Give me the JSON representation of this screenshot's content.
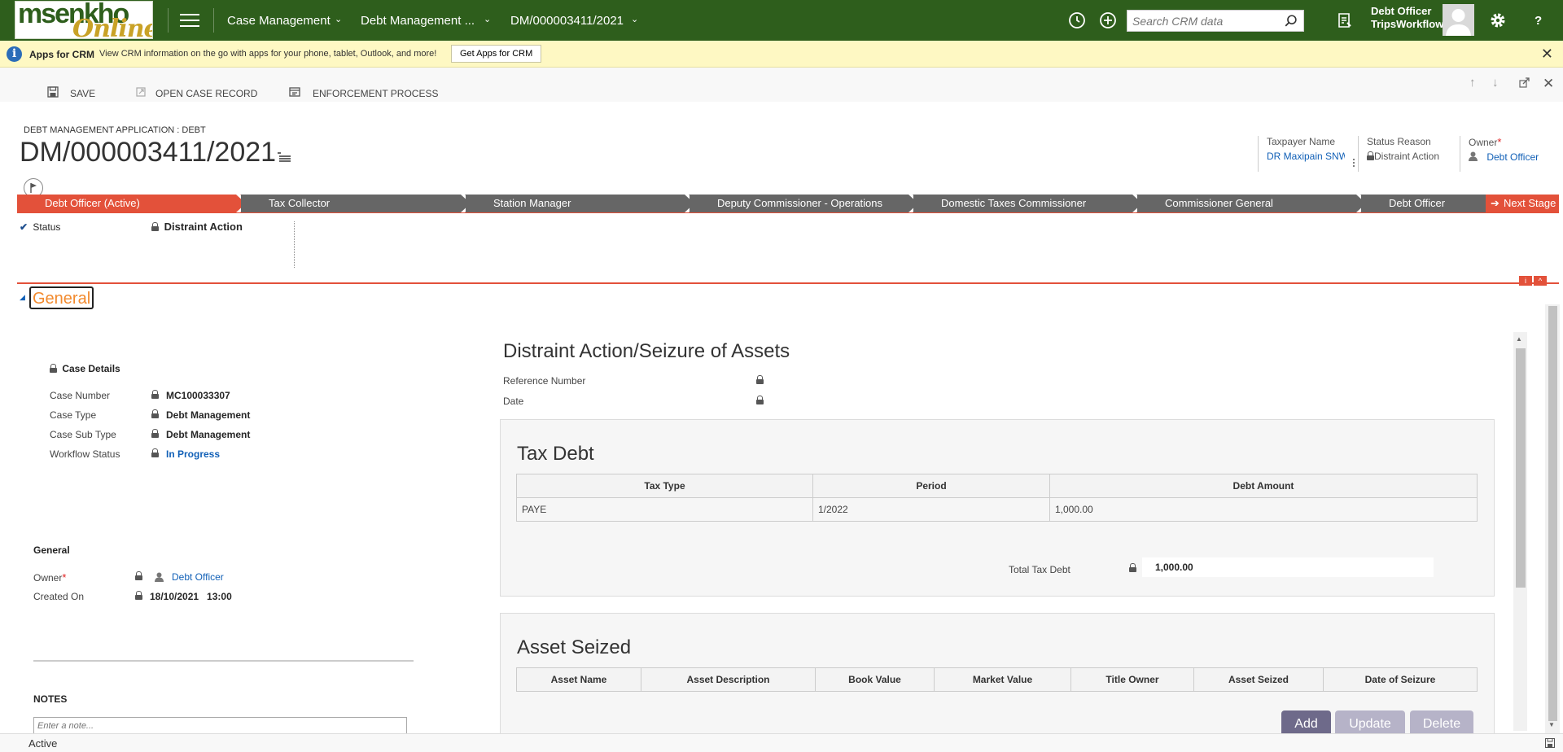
{
  "navbar": {
    "logo_text_1": "msenkho",
    "logo_text_2": "Online",
    "nav_items": [
      "Case Management",
      "Debt Management ...",
      "DM/000003411/2021"
    ],
    "search_placeholder": "Search CRM data",
    "user_role": "Debt Officer",
    "user_org": "TripsWorkflow",
    "help": "?"
  },
  "infobar": {
    "title": "Apps for CRM",
    "text": "View CRM information on the go with apps for your phone, tablet, Outlook, and more!",
    "button": "Get Apps for CRM"
  },
  "commands": [
    "SAVE",
    "OPEN CASE RECORD",
    "ENFORCEMENT PROCESS"
  ],
  "header": {
    "entity_type": "DEBT MANAGEMENT APPLICATION : DEBT",
    "title": "DM/000003411/2021",
    "fields": [
      {
        "label": "Taxpayer Name",
        "value": "DR Maxipain SNW"
      },
      {
        "label": "Status Reason",
        "value": "Distraint Action"
      },
      {
        "label": "Owner",
        "value": "Debt Officer"
      }
    ]
  },
  "process": {
    "stages": [
      "Debt Officer (Active)",
      "Tax Collector",
      "Station Manager",
      "Deputy Commissioner - Operations",
      "Domestic Taxes Commissioner",
      "Commissioner General",
      "Debt Officer"
    ],
    "active_index": 0,
    "next_stage": "Next Stage",
    "status_label": "Status",
    "status_value": "Distraint Action"
  },
  "general": {
    "section_title": "General",
    "case_details_title": "Case Details",
    "case_fields": [
      {
        "label": "Case Number",
        "value": "MC100033307"
      },
      {
        "label": "Case Type",
        "value": "Debt Management"
      },
      {
        "label": "Case Sub Type",
        "value": "Debt Management"
      },
      {
        "label": "Workflow Status",
        "value": "In Progress"
      }
    ],
    "general_title": "General",
    "owner_label": "Owner",
    "owner_value": "Debt Officer",
    "created_label": "Created On",
    "created_value": "18/10/2021   13:00",
    "notes_title": "NOTES",
    "note_placeholder": "Enter a note..."
  },
  "distraint": {
    "title": "Distraint Action/Seizure of Assets",
    "ref_label": "Reference Number",
    "date_label": "Date"
  },
  "tax_debt": {
    "title": "Tax Debt",
    "columns": [
      "Tax Type",
      "Period",
      "Debt Amount"
    ],
    "rows": [
      [
        "PAYE",
        "1/2022",
        "1,000.00"
      ]
    ],
    "total_label": "Total Tax Debt",
    "total_value": "1,000.00"
  },
  "asset_seized": {
    "title": "Asset Seized",
    "columns": [
      "Asset Name",
      "Asset Description",
      "Book Value",
      "Market Value",
      "Title Owner",
      "Asset Seized",
      "Date of Seizure"
    ],
    "buttons": [
      "Add",
      "Update",
      "Delete"
    ]
  },
  "statusbar": {
    "status": "Active"
  },
  "colors": {
    "nav": "#2e5e1c",
    "stage_active": "#e3513a",
    "stage": "#666666",
    "link": "#1160b7"
  }
}
